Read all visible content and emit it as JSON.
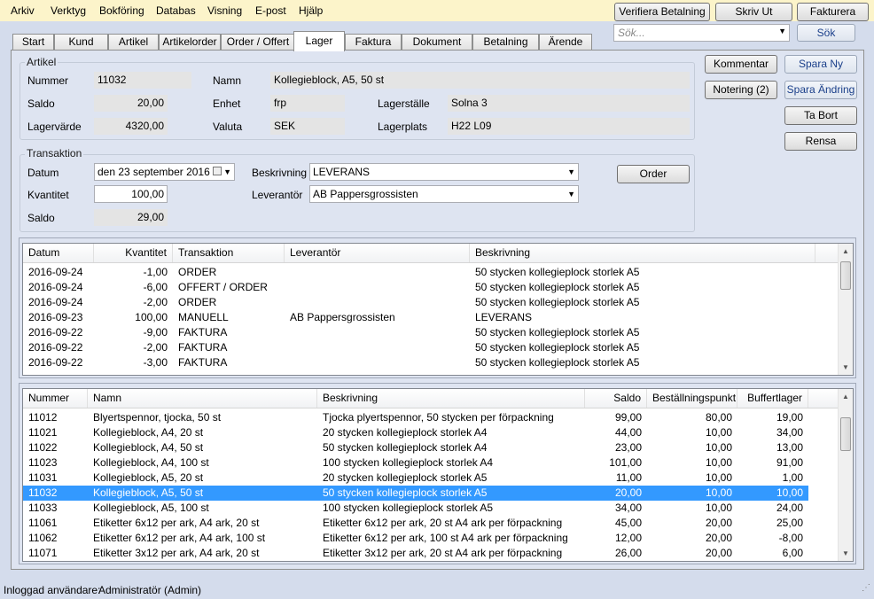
{
  "menu": [
    "Arkiv",
    "Verktyg",
    "Bokföring",
    "Databas",
    "Visning",
    "E-post",
    "Hjälp"
  ],
  "top_buttons": {
    "verify": "Verifiera Betalning",
    "print": "Skriv Ut",
    "invoice": "Fakturera"
  },
  "search": {
    "placeholder": "Sök...",
    "button": "Sök"
  },
  "tabs": [
    "Start",
    "Kund",
    "Artikel",
    "Artikelorder",
    "Order / Offert",
    "Lager",
    "Faktura",
    "Dokument",
    "Betalning",
    "Ärende"
  ],
  "active_tab": "Lager",
  "artikel": {
    "title": "Artikel",
    "labels": {
      "nummer": "Nummer",
      "namn": "Namn",
      "saldo": "Saldo",
      "enhet": "Enhet",
      "lagerstalle": "Lagerställe",
      "lagervarde": "Lagervärde",
      "valuta": "Valuta",
      "lagerplats": "Lagerplats"
    },
    "values": {
      "nummer": "11032",
      "namn": "Kollegieblock, A5, 50 st",
      "saldo": "20,00",
      "enhet": "frp",
      "lagerstalle": "Solna 3",
      "lagervarde": "4320,00",
      "valuta": "SEK",
      "lagerplats": "H22 L09"
    }
  },
  "side_buttons": {
    "kommentar": "Kommentar",
    "notering": "Notering (2)",
    "spara_ny": "Spara Ny",
    "spara_andring": "Spara Ändring",
    "ta_bort": "Ta Bort",
    "rensa": "Rensa"
  },
  "transaktion": {
    "title": "Transaktion",
    "labels": {
      "datum": "Datum",
      "kvantitet": "Kvantitet",
      "saldo": "Saldo",
      "beskrivning": "Beskrivning",
      "leverantor": "Leverantör"
    },
    "values": {
      "datum": "den 23 september 2016",
      "kvantitet": "100,00",
      "saldo": "29,00",
      "beskrivning": "LEVERANS",
      "leverantor": "AB Pappersgrossisten"
    },
    "order_button": "Order"
  },
  "trans_table": {
    "columns": [
      "Datum",
      "Kvantitet",
      "Transaktion",
      "Leverantör",
      "Beskrivning"
    ],
    "rows": [
      [
        "2016-09-24",
        "-1,00",
        "ORDER",
        "",
        "50 stycken kollegieplock storlek A5"
      ],
      [
        "2016-09-24",
        "-6,00",
        "OFFERT / ORDER",
        "",
        "50 stycken kollegieplock storlek A5"
      ],
      [
        "2016-09-24",
        "-2,00",
        "ORDER",
        "",
        "50 stycken kollegieplock storlek A5"
      ],
      [
        "2016-09-23",
        "100,00",
        "MANUELL",
        "AB Pappersgrossisten",
        "LEVERANS"
      ],
      [
        "2016-09-22",
        "-9,00",
        "FAKTURA",
        "",
        "50 stycken kollegieplock storlek A5"
      ],
      [
        "2016-09-22",
        "-2,00",
        "FAKTURA",
        "",
        "50 stycken kollegieplock storlek A5"
      ],
      [
        "2016-09-22",
        "-3,00",
        "FAKTURA",
        "",
        "50 stycken kollegieplock storlek A5"
      ]
    ]
  },
  "article_table": {
    "columns": [
      "Nummer",
      "Namn",
      "Beskrivning",
      "Saldo",
      "Beställningspunkt",
      "Buffertlager"
    ],
    "selected_index": 5,
    "rows": [
      [
        "11012",
        "Blyertspennor, tjocka, 50 st",
        "Tjocka plyertspennor, 50 stycken per förpackning",
        "99,00",
        "80,00",
        "19,00"
      ],
      [
        "11021",
        "Kollegieblock, A4, 20 st",
        "20 stycken kollegieplock storlek A4",
        "44,00",
        "10,00",
        "34,00"
      ],
      [
        "11022",
        "Kollegieblock, A4, 50 st",
        "50 stycken kollegieplock storlek A4",
        "23,00",
        "10,00",
        "13,00"
      ],
      [
        "11023",
        "Kollegieblock, A4, 100 st",
        "100 stycken kollegieplock storlek A4",
        "101,00",
        "10,00",
        "91,00"
      ],
      [
        "11031",
        "Kollegieblock, A5, 20 st",
        "20 stycken kollegieplock storlek A5",
        "11,00",
        "10,00",
        "1,00"
      ],
      [
        "11032",
        "Kollegieblock, A5, 50 st",
        "50 stycken kollegieplock storlek A5",
        "20,00",
        "10,00",
        "10,00"
      ],
      [
        "11033",
        "Kollegieblock, A5, 100 st",
        "100 stycken kollegieplock storlek A5",
        "34,00",
        "10,00",
        "24,00"
      ],
      [
        "11061",
        "Etiketter 6x12 per ark, A4 ark, 20 st",
        "Etiketter 6x12 per ark, 20 st A4 ark per förpackning",
        "45,00",
        "20,00",
        "25,00"
      ],
      [
        "11062",
        "Etiketter 6x12 per ark, A4 ark, 100 st",
        "Etiketter 6x12 per ark, 100 st A4 ark per förpackning",
        "12,00",
        "20,00",
        "-8,00"
      ],
      [
        "11071",
        "Etiketter 3x12 per ark, A4 ark, 20 st",
        "Etiketter 3x12 per ark, 20 st A4 ark per förpackning",
        "26,00",
        "20,00",
        "6,00"
      ]
    ]
  },
  "status": {
    "label": "Inloggad användare:",
    "user": "Administratör (Admin)"
  }
}
